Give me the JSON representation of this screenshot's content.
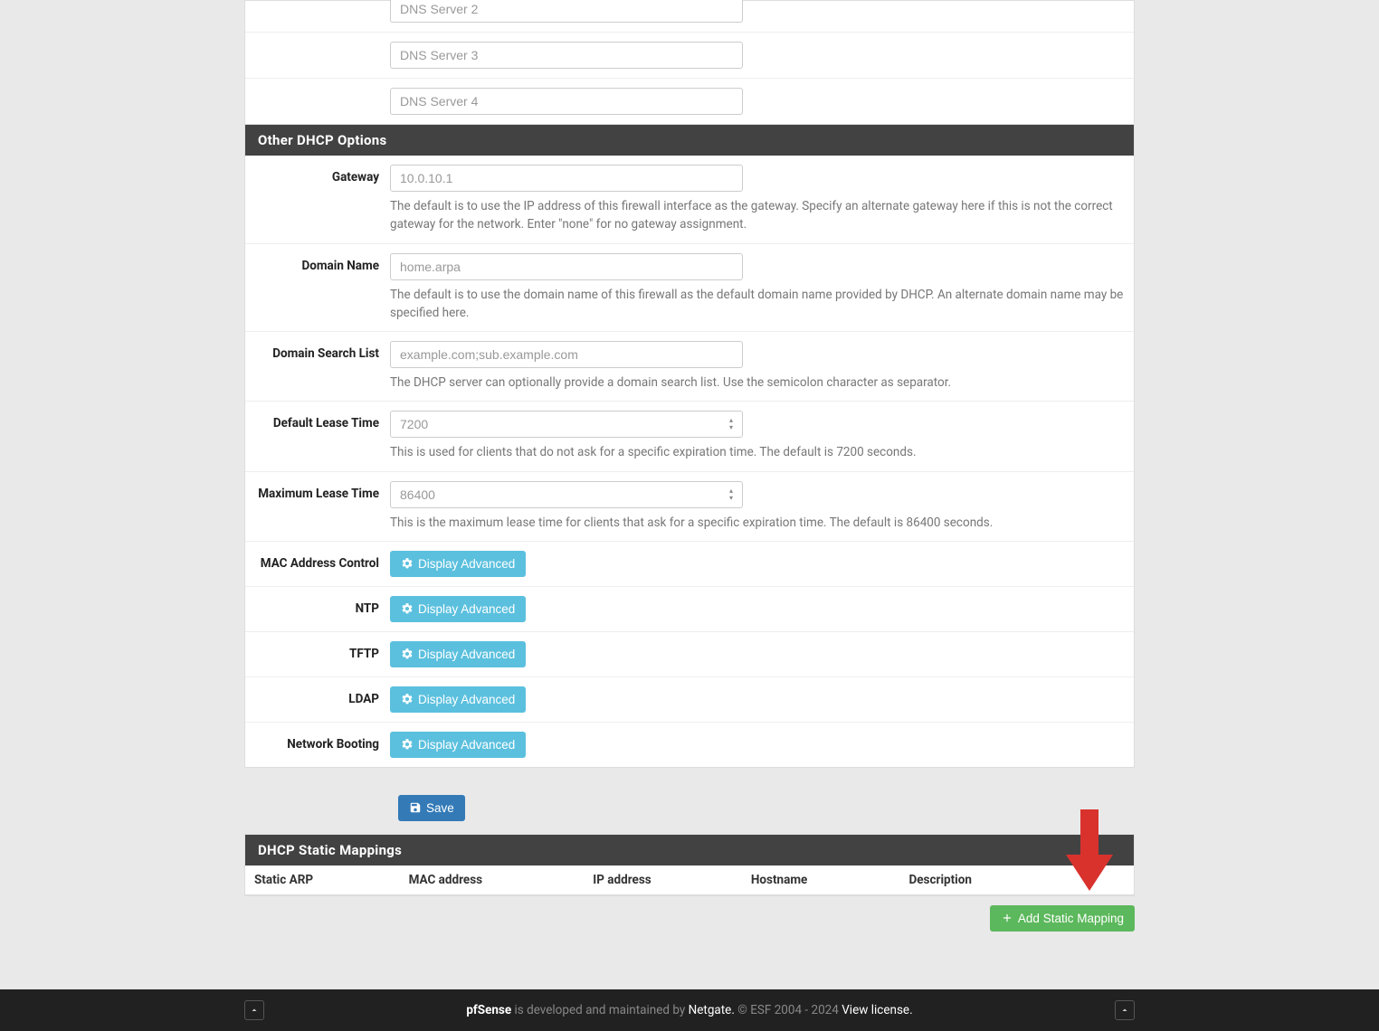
{
  "dns": {
    "server2_placeholder": "DNS Server 2",
    "server3_placeholder": "DNS Server 3",
    "server4_placeholder": "DNS Server 4"
  },
  "section_other_header": "Other DHCP Options",
  "gateway": {
    "label": "Gateway",
    "placeholder": "10.0.10.1",
    "help": "The default is to use the IP address of this firewall interface as the gateway. Specify an alternate gateway here if this is not the correct gateway for the network. Enter \"none\" for no gateway assignment."
  },
  "domain_name": {
    "label": "Domain Name",
    "placeholder": "home.arpa",
    "help": "The default is to use the domain name of this firewall as the default domain name provided by DHCP. An alternate domain name may be specified here."
  },
  "domain_search": {
    "label": "Domain Search List",
    "placeholder": "example.com;sub.example.com",
    "help": "The DHCP server can optionally provide a domain search list. Use the semicolon character as separator."
  },
  "default_lease": {
    "label": "Default Lease Time",
    "placeholder": "7200",
    "help": "This is used for clients that do not ask for a specific expiration time. The default is 7200 seconds."
  },
  "max_lease": {
    "label": "Maximum Lease Time",
    "placeholder": "86400",
    "help": "This is the maximum lease time for clients that ask for a specific expiration time. The default is 86400 seconds."
  },
  "advanced_btn_label": "Display Advanced",
  "mac_control_label": "MAC Address Control",
  "ntp_label": "NTP",
  "tftp_label": "TFTP",
  "ldap_label": "LDAP",
  "netboot_label": "Network Booting",
  "save_label": "Save",
  "static_map_header": "DHCP Static Mappings",
  "table_cols": {
    "static_arp": "Static ARP",
    "mac": "MAC address",
    "ip": "IP address",
    "hostname": "Hostname",
    "description": "Description"
  },
  "add_static_label": "Add Static Mapping",
  "footer": {
    "product": "pfSense",
    "text1": " is developed and maintained by ",
    "company": "Netgate.",
    "copyright": " © ESF 2004 - 2024 ",
    "license": "View license."
  }
}
